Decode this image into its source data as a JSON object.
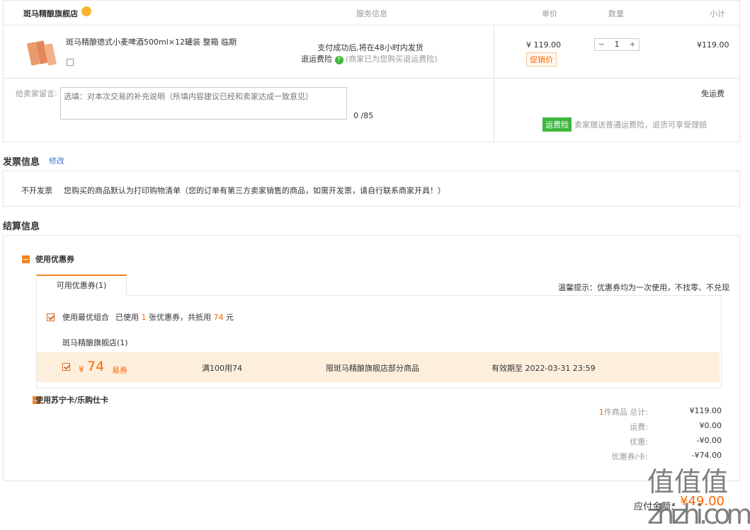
{
  "header": {
    "shop_name": "斑马精酿旗舰店",
    "col_service": "服务信息",
    "col_price": "单价",
    "col_qty": "数量",
    "col_subtotal": "小计"
  },
  "product": {
    "title": "斑马精酿德式小麦啤酒500ml×12罐装 整箱 临期",
    "service_line1": "支付成功后,将在48小时内发货",
    "service_line2_label": "退运费险",
    "service_line2_note": "(商家已为您购买退运费险)",
    "price": "¥ 119.00",
    "promo": "促销价",
    "qty": "1",
    "minus": "−",
    "plus": "+",
    "subtotal": "¥119.00"
  },
  "message": {
    "label": "给卖家留言:",
    "placeholder": "选填：对本次交易的补充说明（所填内容建议已经和卖家达成一致意见）",
    "counter": "0 /85",
    "shipping": "免运费",
    "insurance_tag": "运费险",
    "insurance_note": "卖家赠送普通运费险，退货可享受理赔"
  },
  "invoice": {
    "title": "发票信息",
    "edit": "修改",
    "type": "不开发票",
    "note": "您购买的商品默认为打印购物清单（您的订单有第三方卖家销售的商品，如需开发票，请自行联系商家开具！）"
  },
  "settlement": {
    "title": "结算信息",
    "coupon_toggle": "使用优惠券",
    "tab_available": "可用优惠券(1)",
    "tip": "温馨提示：优惠券均为一次使用，不找零、不兑现",
    "best_combo": "使用最优组合",
    "used_prefix": "已使用",
    "used_count": "1",
    "used_mid": "张优惠券，共抵用",
    "used_amount": "74",
    "used_suffix": "元",
    "shop_coupons": "斑马精酿旗舰店(1)",
    "coupon": {
      "currency": "¥",
      "amount": "74",
      "type": "易券",
      "rule": "满100用74",
      "scope": "限斑马精酿旗舰店部分商品",
      "expiry": "有效期至 2022-03-31 23:59"
    },
    "card_toggle": "使用苏宁卡/乐购仕卡"
  },
  "summary": {
    "items_count": "1",
    "items_label": "件商品 总计:",
    "items_total": "¥119.00",
    "shipping_label": "运费:",
    "shipping_value": "¥0.00",
    "discount_label": "优惠:",
    "discount_value": "-¥0.00",
    "coupon_label": "优惠券/卡:",
    "coupon_value": "-¥74.00",
    "payable_label": "应付金额:",
    "payable_value": "¥49.00"
  },
  "watermark": "值 值 值  zhizhi.com",
  "colors": {
    "accent": "#ff6600",
    "green": "#3cb73c",
    "coupon_bg": "#fdefdc"
  }
}
